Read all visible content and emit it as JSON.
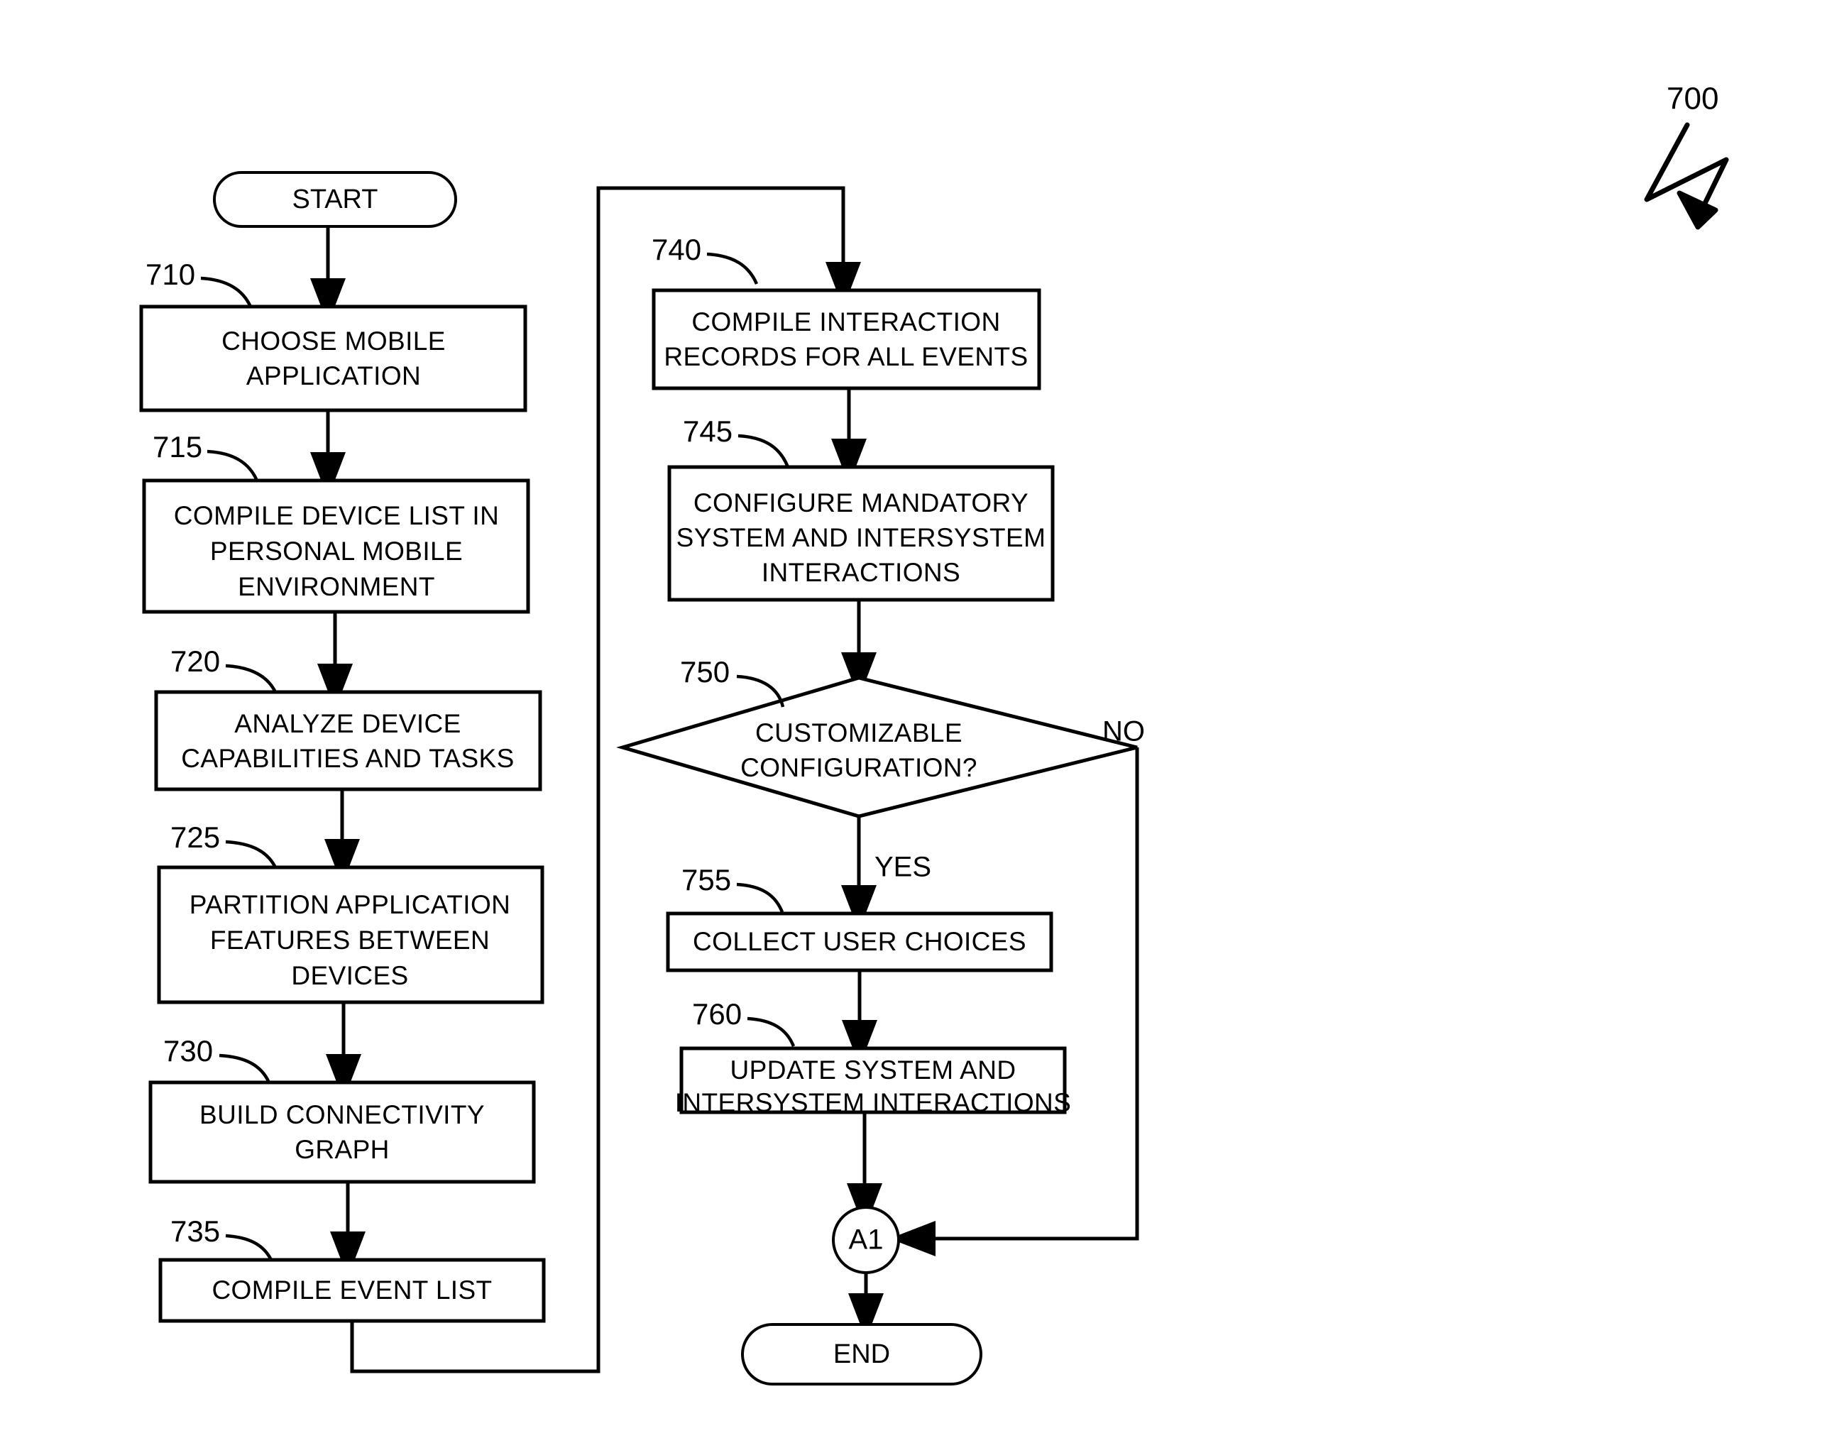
{
  "figure": {
    "number": "700",
    "pointer_icon": "zigzag-arrow-icon"
  },
  "terminals": {
    "start": "START",
    "end": "END"
  },
  "connector_node": {
    "label": "A1"
  },
  "branches": {
    "yes": "YES",
    "no": "NO"
  },
  "left_column": [
    {
      "ref": "710",
      "lines": [
        "CHOOSE MOBILE",
        "APPLICATION"
      ]
    },
    {
      "ref": "715",
      "lines": [
        "COMPILE DEVICE LIST IN",
        "PERSONAL MOBILE",
        "ENVIRONMENT"
      ]
    },
    {
      "ref": "720",
      "lines": [
        "ANALYZE DEVICE",
        "CAPABILITIES AND TASKS"
      ]
    },
    {
      "ref": "725",
      "lines": [
        "PARTITION APPLICATION",
        "FEATURES BETWEEN",
        "DEVICES"
      ]
    },
    {
      "ref": "730",
      "lines": [
        "BUILD CONNECTIVITY",
        "GRAPH"
      ]
    },
    {
      "ref": "735",
      "lines": [
        "COMPILE EVENT LIST"
      ]
    }
  ],
  "right_column": [
    {
      "ref": "740",
      "lines": [
        "COMPILE INTERACTION",
        "RECORDS FOR ALL EVENTS"
      ]
    },
    {
      "ref": "745",
      "lines": [
        "CONFIGURE MANDATORY",
        "SYSTEM AND INTERSYSTEM",
        "INTERACTIONS"
      ]
    },
    {
      "ref": "750",
      "lines": [
        "CUSTOMIZABLE",
        "CONFIGURATION?"
      ],
      "shape": "decision"
    },
    {
      "ref": "755",
      "lines": [
        "COLLECT USER CHOICES"
      ]
    },
    {
      "ref": "760",
      "lines": [
        "UPDATE SYSTEM AND",
        "INTERSYSTEM INTERACTIONS"
      ]
    }
  ],
  "colors": {
    "stroke": "#000000",
    "fill": "#ffffff"
  }
}
